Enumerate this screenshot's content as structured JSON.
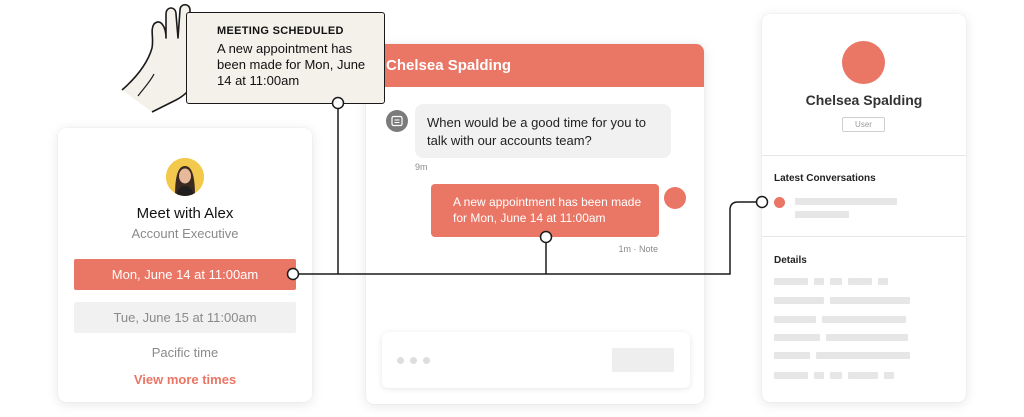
{
  "notification": {
    "title": "MEETING SCHEDULED",
    "body": "A new appointment has been made for Mon, June 14 at 11:00am"
  },
  "meeting_card": {
    "title": "Meet with Alex",
    "subtitle": "Account Executive",
    "slots": [
      {
        "label": "Mon, June 14 at 11:00am",
        "selected": true
      },
      {
        "label": "Tue, June 15 at 11:00am",
        "selected": false
      }
    ],
    "timezone": "Pacific time",
    "more_link": "View more times"
  },
  "chat": {
    "header": "Chelsea Spalding",
    "incoming_message": "When would be a good time for you to talk with our accounts team?",
    "incoming_time": "9m",
    "outgoing_message": "A new appointment has been made for Mon, June 14 at 11:00am",
    "outgoing_meta": "1m · Note"
  },
  "profile": {
    "name": "Chelsea Spalding",
    "role": "User",
    "latest_conversations_label": "Latest Conversations",
    "details_label": "Details"
  },
  "colors": {
    "accent": "#ea7665",
    "note_bg": "#f4f1ea",
    "placeholder": "#e6e6e6"
  }
}
